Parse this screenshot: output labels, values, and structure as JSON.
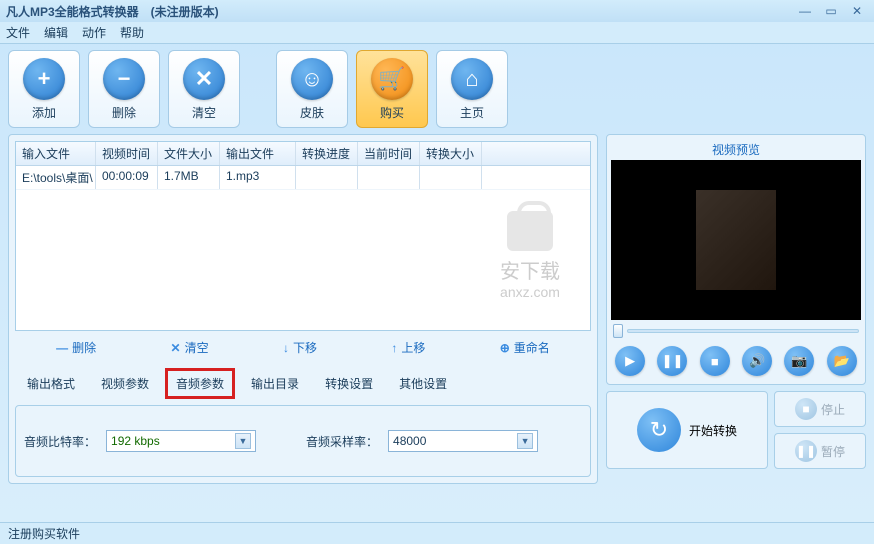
{
  "window": {
    "title": "凡人MP3全能格式转换器　(未注册版本)"
  },
  "menu": {
    "file": "文件",
    "edit": "编辑",
    "action": "动作",
    "help": "帮助"
  },
  "toolbar": {
    "add": "添加",
    "delete": "删除",
    "clear": "清空",
    "skin": "皮肤",
    "buy": "购买",
    "home": "主页"
  },
  "table": {
    "headers": {
      "input": "输入文件",
      "vtime": "视频时间",
      "fsize": "文件大小",
      "output": "输出文件",
      "progress": "转换进度",
      "ctime": "当前时间",
      "csize": "转换大小"
    },
    "rows": [
      {
        "input": "E:\\tools\\桌面\\",
        "vtime": "00:00:09",
        "fsize": "1.7MB",
        "output": "1.mp3",
        "progress": "",
        "ctime": "",
        "csize": ""
      }
    ]
  },
  "watermark": {
    "cn": "安下载",
    "en": "anxz.com"
  },
  "list_actions": {
    "delete": "删除",
    "clear": "清空",
    "down": "下移",
    "up": "上移",
    "rename": "重命名"
  },
  "tabs": {
    "out_format": "输出格式",
    "video_params": "视频参数",
    "audio_params": "音频参数",
    "out_dir": "输出目录",
    "convert_settings": "转换设置",
    "other_settings": "其他设置"
  },
  "params": {
    "bitrate_label": "音频比特率：",
    "bitrate_value": "192 kbps",
    "samplerate_label": "音频采样率：",
    "samplerate_value": "48000"
  },
  "preview": {
    "title": "视频预览"
  },
  "actions": {
    "start": "开始转换",
    "stop": "停止",
    "pause": "暂停"
  },
  "status": {
    "register": "注册购买软件"
  }
}
